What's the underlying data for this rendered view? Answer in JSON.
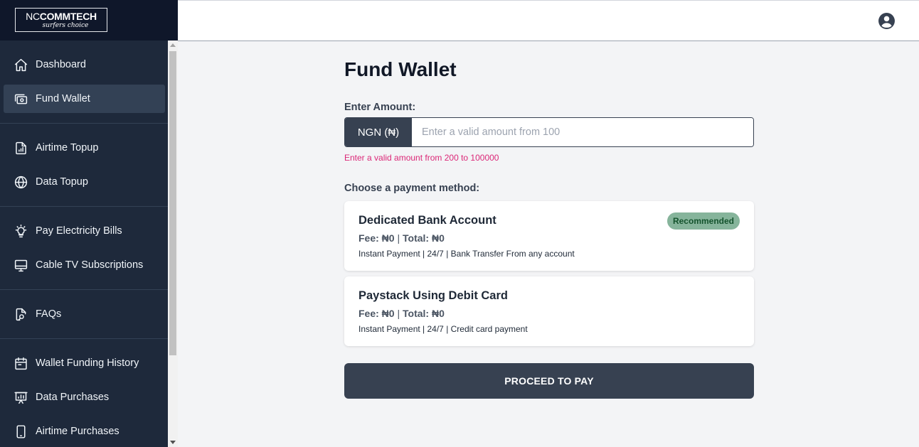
{
  "brand": {
    "name_light": "NC",
    "name_bold": "COMMTECH",
    "tagline": "surfers choice"
  },
  "sidebar": {
    "groups": [
      {
        "items": [
          {
            "label": "Dashboard",
            "icon": "home-icon"
          },
          {
            "label": "Fund Wallet",
            "icon": "wallet-icon",
            "active": true
          }
        ]
      },
      {
        "items": [
          {
            "label": "Airtime Topup",
            "icon": "phone-signal-icon"
          },
          {
            "label": "Data Topup",
            "icon": "globe-icon"
          }
        ]
      },
      {
        "items": [
          {
            "label": "Pay Electricity Bills",
            "icon": "lightbulb-icon"
          },
          {
            "label": "Cable TV Subscriptions",
            "icon": "monitor-icon"
          }
        ]
      },
      {
        "items": [
          {
            "label": "FAQs",
            "icon": "document-search-icon"
          }
        ]
      },
      {
        "items": [
          {
            "label": "Wallet Funding History",
            "icon": "calendar-icon"
          },
          {
            "label": "Data Purchases",
            "icon": "presentation-chart-icon"
          },
          {
            "label": "Airtime Purchases",
            "icon": "phone-icon"
          }
        ]
      }
    ]
  },
  "header": {
    "user_icon": "user-circle-icon"
  },
  "main": {
    "title": "Fund Wallet",
    "amount": {
      "label": "Enter Amount:",
      "currency": "NGN (₦)",
      "placeholder": "Enter a valid amount from 100",
      "value": "",
      "error": "Enter a valid amount from 200 to 100000"
    },
    "payment_label": "Choose a payment method:",
    "methods": [
      {
        "title": "Dedicated Bank Account",
        "fee": "Fee: ₦0",
        "separator": " | ",
        "total": "Total: ₦0",
        "description": "Instant Payment | 24/7 | Bank Transfer From any account",
        "badge": "Recommended"
      },
      {
        "title": "Paystack Using Debit Card",
        "fee": "Fee: ₦0",
        "separator": " | ",
        "total": "Total: ₦0",
        "description": "Instant Payment | 24/7 | Credit card payment"
      }
    ],
    "proceed_label": "PROCEED TO PAY"
  },
  "colors": {
    "sidebar_bg": "#1e293b",
    "logo_bg": "#0f172a",
    "accent": "#374151",
    "error": "#db2777",
    "badge_bg": "#86b49b"
  }
}
